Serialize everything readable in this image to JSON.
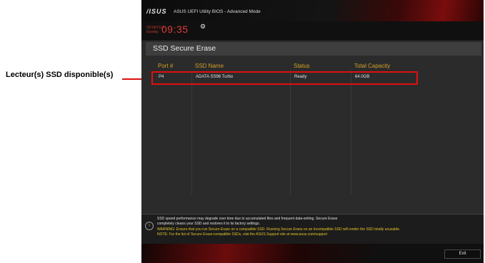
{
  "callout": {
    "label": "Lecteur(s) SSD disponible(s)"
  },
  "header": {
    "logo": "/ISUS",
    "title": "ASUS UEFI Utility BIOS - Advanced Mode",
    "date": "02/18/2114",
    "day": "Sunday",
    "time": "09:35",
    "settings_icon": "gear-icon"
  },
  "page": {
    "title": "SSD Secure Erase",
    "columns": [
      "Port #",
      "SSD Name",
      "Status",
      "Total Capacity"
    ],
    "rows": [
      {
        "port": "P4",
        "name": "ADATA SS96 Turbo",
        "status": "Ready",
        "capacity": "64.0GB"
      }
    ]
  },
  "info": {
    "icon": "info-icon",
    "lines": [
      "SSD speed performance may degrade over time due to accumulated files and frequent data-writing. Secure Erase",
      "completely cleans your SSD and restores it to its factory settings.",
      "WARNING: Ensure that you run Secure Erase on a compatible SSD. Running Secure Erase on an incompatible SSD will render the SSD totally unusable.",
      "NOTE: For the list of Secure Erase-compatible SSDs, visit the ASUS Support site at www.asus.com/support"
    ]
  },
  "footer": {
    "exit_label": "Exit"
  },
  "colors": {
    "accent": "#d1a12a",
    "highlight": "#e01010",
    "warning": "#e5c428"
  }
}
